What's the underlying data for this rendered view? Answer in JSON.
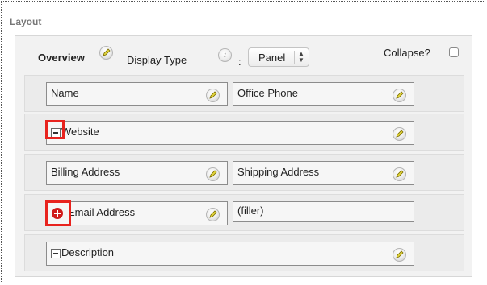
{
  "layout": {
    "title": "Layout"
  },
  "panel": {
    "title": "Overview",
    "display_type_label": "Display Type",
    "colon": ":",
    "display_type_value": "Panel",
    "collapse_label": "Collapse?",
    "collapse_checked": false,
    "rows": [
      {
        "fields": [
          "Name",
          "Office Phone"
        ]
      },
      {
        "fields": [
          "Website"
        ]
      },
      {
        "fields": [
          "Billing Address",
          "Shipping Address"
        ]
      },
      {
        "fields": [
          "Email Address",
          "(filler)"
        ]
      },
      {
        "fields": [
          "Description"
        ]
      }
    ]
  },
  "icons": {
    "edit": "pencil-icon",
    "info": "info-icon",
    "minus": "minus-box-icon",
    "plus": "plus-circle-icon"
  },
  "colors": {
    "highlight": "#e8231e",
    "plus": "#d01a1a",
    "pencil": "#e0d33a"
  }
}
